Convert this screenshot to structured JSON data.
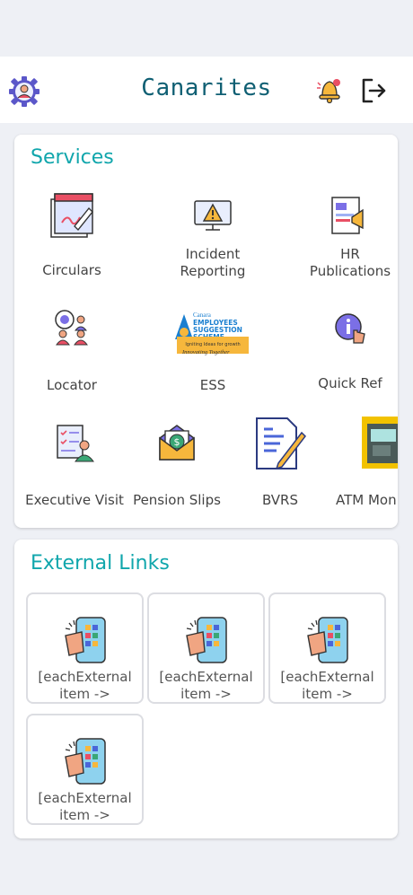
{
  "app": {
    "title": "Canarites"
  },
  "header": {
    "profile_icon": "profile-gear-icon",
    "notification_icon": "bell-icon",
    "logout_icon": "logout-icon"
  },
  "services": {
    "title": "Services",
    "items": [
      {
        "label": "Circulars",
        "icon": "circulars-icon"
      },
      {
        "label": "Incident\nReporting",
        "icon": "incident-warning-icon"
      },
      {
        "label": "HR\nPublications",
        "icon": "hr-publications-icon"
      },
      {
        "label": "Locator",
        "icon": "locator-icon"
      },
      {
        "label": "ESS",
        "icon": "ess-logo",
        "logo_text": [
          "Canara",
          "EMPLOYEES",
          "SUGGESTION",
          "SCHEME",
          "Igniting Ideas for growth",
          "Innovating Together"
        ]
      },
      {
        "label": "Quick Ref",
        "icon": "quick-ref-icon"
      },
      {
        "label": "Executive Visit",
        "icon": "executive-visit-icon"
      },
      {
        "label": "Pension Slips",
        "icon": "pension-slips-icon"
      },
      {
        "label": "BVRS",
        "icon": "bvrs-icon"
      },
      {
        "label": "ATM Mon",
        "icon": "atm-monitor-icon"
      }
    ]
  },
  "external_links": {
    "title": "External Links",
    "items": [
      {
        "label": "[eachExternal\nitem ->",
        "icon": "mobile-app-icon"
      },
      {
        "label": "[eachExternal\nitem ->",
        "icon": "mobile-app-icon"
      },
      {
        "label": "[eachExternal\nitem ->",
        "icon": "mobile-app-icon"
      },
      {
        "label": "[eachExternal\nitem ->",
        "icon": "mobile-app-icon"
      }
    ]
  },
  "colors": {
    "accent": "#10a6ac",
    "title": "#0f5f73",
    "background": "#eef0f5"
  }
}
